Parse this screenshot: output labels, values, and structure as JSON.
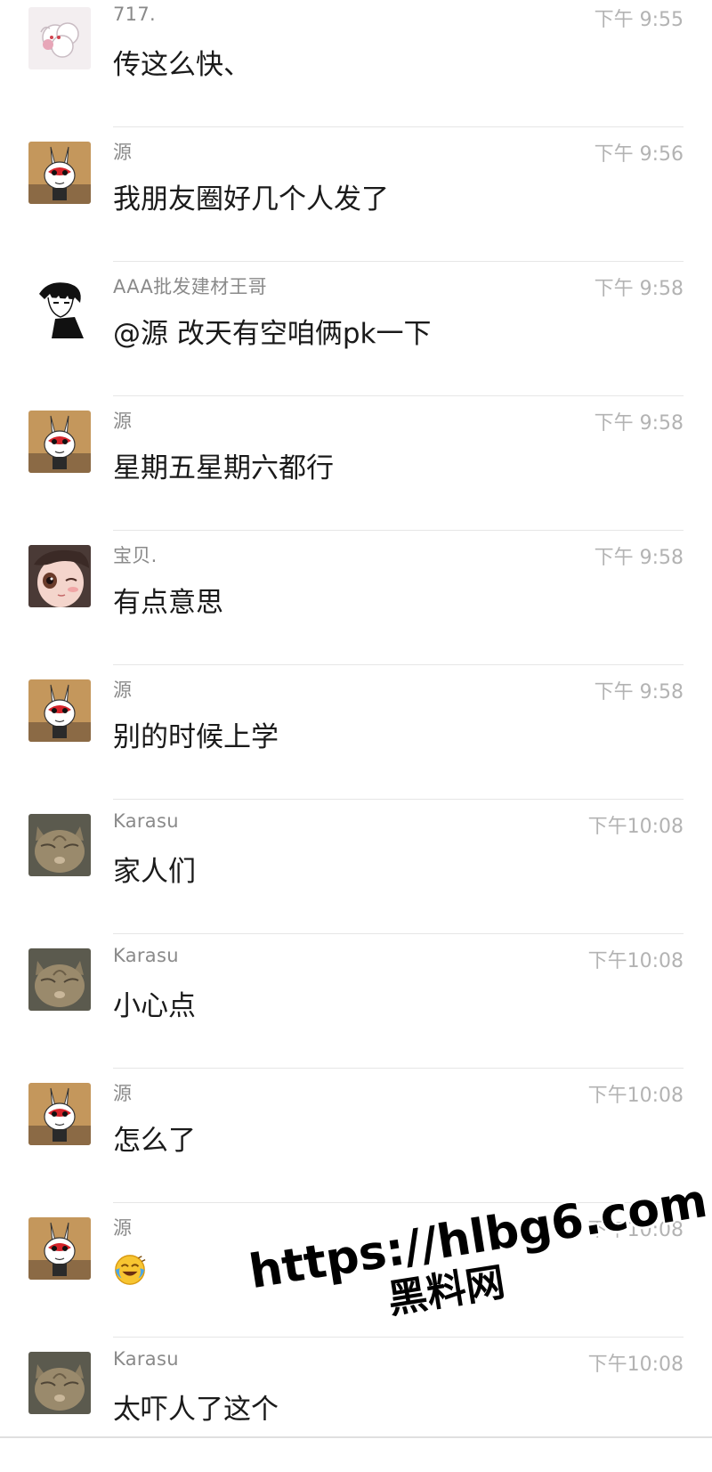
{
  "messages": [
    {
      "sender": "717.",
      "time": "下午 9:55",
      "content": "传这么快、",
      "avatar_icon": "sheep-avatar-icon"
    },
    {
      "sender": "源",
      "time": "下午 9:56",
      "content": "我朋友圈好几个人发了",
      "avatar_icon": "rabbit-mask-avatar-icon"
    },
    {
      "sender": "AAA批发建材王哥",
      "time": "下午 9:58",
      "content": "@源 改天有空咱俩pk一下",
      "avatar_icon": "anime-boy-avatar-icon"
    },
    {
      "sender": "源",
      "time": "下午 9:58",
      "content": "星期五星期六都行",
      "avatar_icon": "rabbit-mask-avatar-icon"
    },
    {
      "sender": "宝贝.",
      "time": "下午 9:58",
      "content": "有点意思",
      "avatar_icon": "doll-girl-avatar-icon"
    },
    {
      "sender": "源",
      "time": "下午 9:58",
      "content": "别的时候上学",
      "avatar_icon": "rabbit-mask-avatar-icon"
    },
    {
      "sender": "Karasu",
      "time": "下午10:08",
      "content": "家人们",
      "avatar_icon": "cat-avatar-icon"
    },
    {
      "sender": "Karasu",
      "time": "下午10:08",
      "content": "小心点",
      "avatar_icon": "cat-avatar-icon"
    },
    {
      "sender": "源",
      "time": "下午10:08",
      "content": "怎么了",
      "avatar_icon": "rabbit-mask-avatar-icon"
    },
    {
      "sender": "源",
      "time": "下午10:08",
      "content": "",
      "content_icon": "crying-laughing-emoji-icon",
      "avatar_icon": "rabbit-mask-avatar-icon"
    },
    {
      "sender": "Karasu",
      "time": "下午10:08",
      "content": "太吓人了这个",
      "avatar_icon": "cat-avatar-icon"
    }
  ],
  "watermark": {
    "url": "https://hlbg6.com",
    "name": "黑料网"
  }
}
